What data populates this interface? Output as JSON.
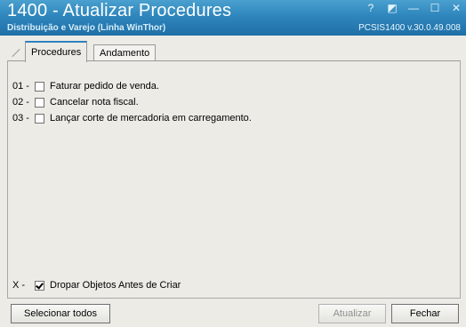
{
  "window": {
    "title": "1400 - Atualizar Procedures",
    "subtitle": "Distribuição e Varejo (Linha WinThor)",
    "system_id": "PCSIS1400  v.30.0.49.008",
    "controls": [
      {
        "name": "help-icon",
        "glyph": "?"
      },
      {
        "name": "restore-icon",
        "glyph": "◩"
      },
      {
        "name": "minimize-icon",
        "glyph": "—"
      },
      {
        "name": "maximize-icon",
        "glyph": "☐"
      },
      {
        "name": "close-icon",
        "glyph": "✕"
      }
    ]
  },
  "tabs": [
    {
      "label": "Procedures",
      "active": true
    },
    {
      "label": "Andamento",
      "active": false
    }
  ],
  "procedures": [
    {
      "num": "01 -",
      "label": "Faturar pedido de venda.",
      "checked": false
    },
    {
      "num": "02 -",
      "label": "Cancelar nota fiscal.",
      "checked": false
    },
    {
      "num": "03 -",
      "label": "Lançar corte de mercadoria em carregamento.",
      "checked": false
    }
  ],
  "drop_option": {
    "num": "X -",
    "label": "Dropar Objetos Antes de Criar",
    "checked": true
  },
  "buttons": {
    "select_all": "Selecionar todos",
    "update": "Atualizar",
    "close": "Fechar"
  }
}
